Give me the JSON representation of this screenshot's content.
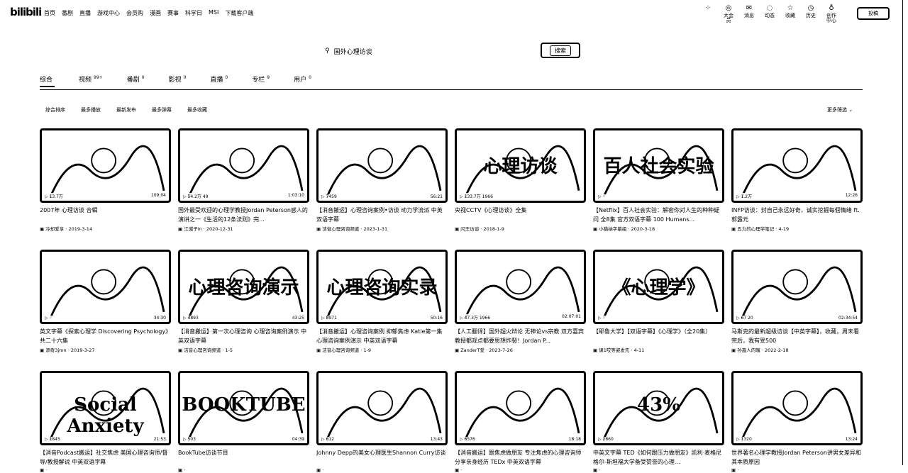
{
  "header": {
    "logo": "bilibili",
    "nav": [
      "首页",
      "番剧",
      "直播",
      "游戏中心",
      "会员购",
      "漫画",
      "赛事",
      "科学日",
      "MSI",
      "下载客户端"
    ],
    "right": [
      {
        "label": "",
        "icon": "grid-icon"
      },
      {
        "label": "大会员",
        "icon": "vip-icon"
      },
      {
        "label": "消息",
        "icon": "message-icon"
      },
      {
        "label": "动态",
        "icon": "feed-icon"
      },
      {
        "label": "收藏",
        "icon": "star-icon"
      },
      {
        "label": "历史",
        "icon": "clock-icon"
      },
      {
        "label": "创作中心",
        "icon": "bulb-icon"
      }
    ],
    "upload": "投稿"
  },
  "search": {
    "query": "国外心理访谈",
    "button": "搜索"
  },
  "tabs": [
    {
      "label": "综合",
      "count": ""
    },
    {
      "label": "视频",
      "count": "99+"
    },
    {
      "label": "番剧",
      "count": "0"
    },
    {
      "label": "影视",
      "count": "0"
    },
    {
      "label": "直播",
      "count": "0"
    },
    {
      "label": "专栏",
      "count": "9"
    },
    {
      "label": "用户",
      "count": "0"
    }
  ],
  "sorts": [
    "综合排序",
    "最多播放",
    "最新发布",
    "最多弹幕",
    "最多收藏"
  ],
  "more_filter": "更多筛选",
  "videos": [
    {
      "title": "2007年 心理访谈 合辑",
      "uploader": "冷却爱享",
      "date": "2019-3-14",
      "views": "13.7万",
      "danmaku": "",
      "duration": "109:04"
    },
    {
      "title": "国外最受欢迎的心理学教授Jordan Peterson感人的演讲之一《生活的12条法则》完...",
      "uploader": "江城子in",
      "date": "2020-12-31",
      "views": "54.2万",
      "danmaku": "49",
      "duration": "1:03:10"
    },
    {
      "title": "【消音搬运】心理咨询案例•访谈 动力学流派 中英双语字幕",
      "uploader": "洁音心理咨询频道",
      "date": "2023-1-31",
      "views": "7459",
      "danmaku": "",
      "duration": "56:21"
    },
    {
      "title": "央视CCTV《心理访谈》全集",
      "uploader": "闪王访谈",
      "date": "2018-1-9",
      "views": "133.7万",
      "danmaku": "1966",
      "duration": "",
      "big": "心理访谈"
    },
    {
      "title": "【Netflix】百人社会实验：解密你对人生的种种疑问 全8集 官方双语字幕 100 Humans...",
      "uploader": "小猫纳字幕组",
      "date": "2020-3-18",
      "views": "",
      "danmaku": "",
      "duration": "",
      "big": "百人社会实验"
    },
    {
      "title": "INFP访谈：封自己永远好奇，诚实挖掘每個情绪 ft. 郭露元",
      "uploader": "五力的心理学笔记",
      "date": "4-19",
      "views": "1.2万",
      "danmaku": "",
      "duration": "12:26"
    },
    {
      "title": "英文字幕《探索心理学 Discovering Psychology》共二十六集",
      "uploader": "添奇3jmn",
      "date": "2019-3-27",
      "views": "",
      "danmaku": "",
      "duration": "34:30"
    },
    {
      "title": "【消音搬运】第一次心理咨询 心理咨询案例演示 中英双语字幕",
      "uploader": "洁音心理咨询频道",
      "date": "1-5",
      "views": "4893",
      "danmaku": "",
      "duration": "43:25",
      "big": "心理咨询演示"
    },
    {
      "title": "【消音搬运】心理咨询案例 抑郁焦虑 Katie第一集 心理咨询案例演示 中英双语字幕",
      "uploader": "洁音心理咨询频道",
      "date": "1-9",
      "views": "8971",
      "danmaku": "",
      "duration": "50:16",
      "big": "心理咨询实录"
    },
    {
      "title": "【人工翻译】国外超火辩论 无神论vs宗教 双方嘉宾教授都观点都要思想炸裂！Jordan P...",
      "uploader": "ZanderT爱",
      "date": "2023-7-26",
      "views": "47.3万",
      "danmaku": "1966",
      "duration": "02:07:01"
    },
    {
      "title": "【耶鲁大学】【双语字幕】《心理学》（全20集）",
      "uploader": "课1哎等姿发先",
      "date": "4-11",
      "views": "",
      "danmaku": "",
      "duration": "",
      "big": "《心理学》"
    },
    {
      "title": "马斯克的最新超级访谈【中英字幕】，收藏，周末看完后，我有受500",
      "uploader": "孙鑫人的嘴",
      "date": "2022-2-18",
      "views": "67",
      "danmaku": "20",
      "duration": "02:34:54"
    },
    {
      "title": "【消音Podcast搬运】社交焦虑 美国心理咨询师/督导/教授解说 中英双语字幕",
      "uploader": "",
      "date": "",
      "views": "1845",
      "danmaku": "",
      "duration": "21:53",
      "big": "Social Anxiety"
    },
    {
      "title": "BookTube访谈节目",
      "uploader": "",
      "date": "",
      "views": "503",
      "danmaku": "",
      "duration": "04:39",
      "big": "BOOKTUBE"
    },
    {
      "title": "Johnny Depp的美女心理医生Shannon Curry访谈",
      "uploader": "",
      "date": "",
      "views": "612",
      "danmaku": "",
      "duration": "13:43"
    },
    {
      "title": "【消音搬运】跟焦虑做朋友 专注焦虑的心理咨询师分享亲身经历 TEDx 中英双语字幕",
      "uploader": "",
      "date": "",
      "views": "6576",
      "danmaku": "",
      "duration": "18:18"
    },
    {
      "title": "中英文字幕 TED《如何跟压力做朋友》凯利·麦格尼格尔-斯坦福大学备受赞誉的心理...",
      "uploader": "",
      "date": "",
      "views": "2860",
      "danmaku": "",
      "duration": "",
      "big": "43%"
    },
    {
      "title": "世界著名心理学教授Jordan Peterson讲男女差异和其本质原因",
      "uploader": "",
      "date": "",
      "views": "1320",
      "danmaku": "",
      "duration": "13:24"
    }
  ]
}
